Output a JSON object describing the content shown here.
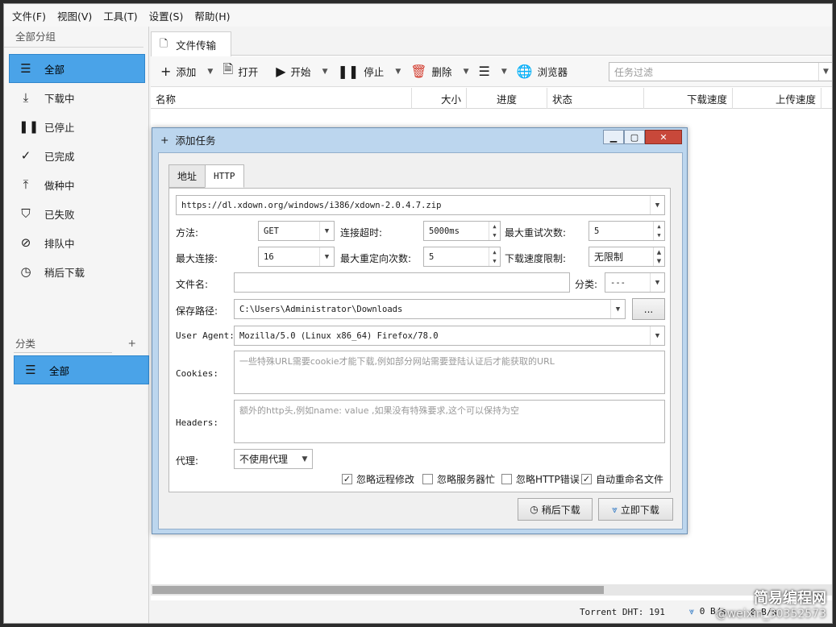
{
  "menu": [
    "文件(F)",
    "视图(V)",
    "工具(T)",
    "设置(S)",
    "帮助(H)"
  ],
  "sidebar": {
    "group_header": "全部分组",
    "items": [
      {
        "label": "全部",
        "icon": "menu-icon"
      },
      {
        "label": "下载中",
        "icon": "download-icon"
      },
      {
        "label": "已停止",
        "icon": "pause-icon"
      },
      {
        "label": "已完成",
        "icon": "check-icon"
      },
      {
        "label": "做种中",
        "icon": "upload-icon"
      },
      {
        "label": "已失败",
        "icon": "shield-alert-icon"
      },
      {
        "label": "排队中",
        "icon": "compass-icon"
      },
      {
        "label": "稍后下载",
        "icon": "clock-icon"
      }
    ],
    "category_header": "分类",
    "category_add": "+",
    "category_item": "全部"
  },
  "tab": {
    "label": "文件传输"
  },
  "toolbar": {
    "add": "添加",
    "open": "打开",
    "start": "开始",
    "stop": "停止",
    "delete": "删除",
    "browser": "浏览器",
    "filter_placeholder": "任务过滤"
  },
  "columns": [
    "名称",
    "大小",
    "进度",
    "状态",
    "下载速度",
    "上传速度"
  ],
  "status": {
    "dht": "Torrent DHT:  191",
    "speed": "0 B/s",
    "speed2": "0 B/s"
  },
  "dialog": {
    "title": "添加任务",
    "tabs": [
      "地址",
      "HTTP"
    ],
    "url": "https://dl.xdown.org/windows/i386/xdown-2.0.4.7.zip",
    "method_label": "方法:",
    "method": "GET",
    "timeout_label": "连接超时:",
    "timeout": "5000ms",
    "retry_label": "最大重试次数:",
    "retry": "5",
    "maxconn_label": "最大连接:",
    "maxconn": "16",
    "redirect_label": "最大重定向次数:",
    "redirect": "5",
    "speedlimit_label": "下载速度限制:",
    "speedlimit": "无限制",
    "filename_label": "文件名:",
    "filename": "",
    "category_label": "分类:",
    "category": "---",
    "savepath_label": "保存路径:",
    "savepath": "C:\\Users\\Administrator\\Downloads",
    "browse": "...",
    "ua_label": "User Agent:",
    "ua": "Mozilla/5.0 (Linux x86_64) Firefox/78.0",
    "cookies_label": "Cookies:",
    "cookies_placeholder": "一些特殊URL需要cookie才能下载,例如部分网站需要登陆认证后才能获取的URL",
    "headers_label": "Headers:",
    "headers_placeholder": "额外的http头,例如name: value ,如果没有特殊要求,这个可以保持为空",
    "proxy_label": "代理:",
    "proxy": "不使用代理",
    "checks": [
      {
        "label": "忽略远程修改",
        "checked": true
      },
      {
        "label": "忽略服务器忙",
        "checked": false
      },
      {
        "label": "忽略HTTP错误",
        "checked": false
      },
      {
        "label": "自动重命名文件",
        "checked": true
      }
    ],
    "later_btn": "稍后下载",
    "now_btn": "立即下载"
  },
  "watermark": {
    "brand": "简易编程网",
    "handle": "@weixin_30352573"
  }
}
